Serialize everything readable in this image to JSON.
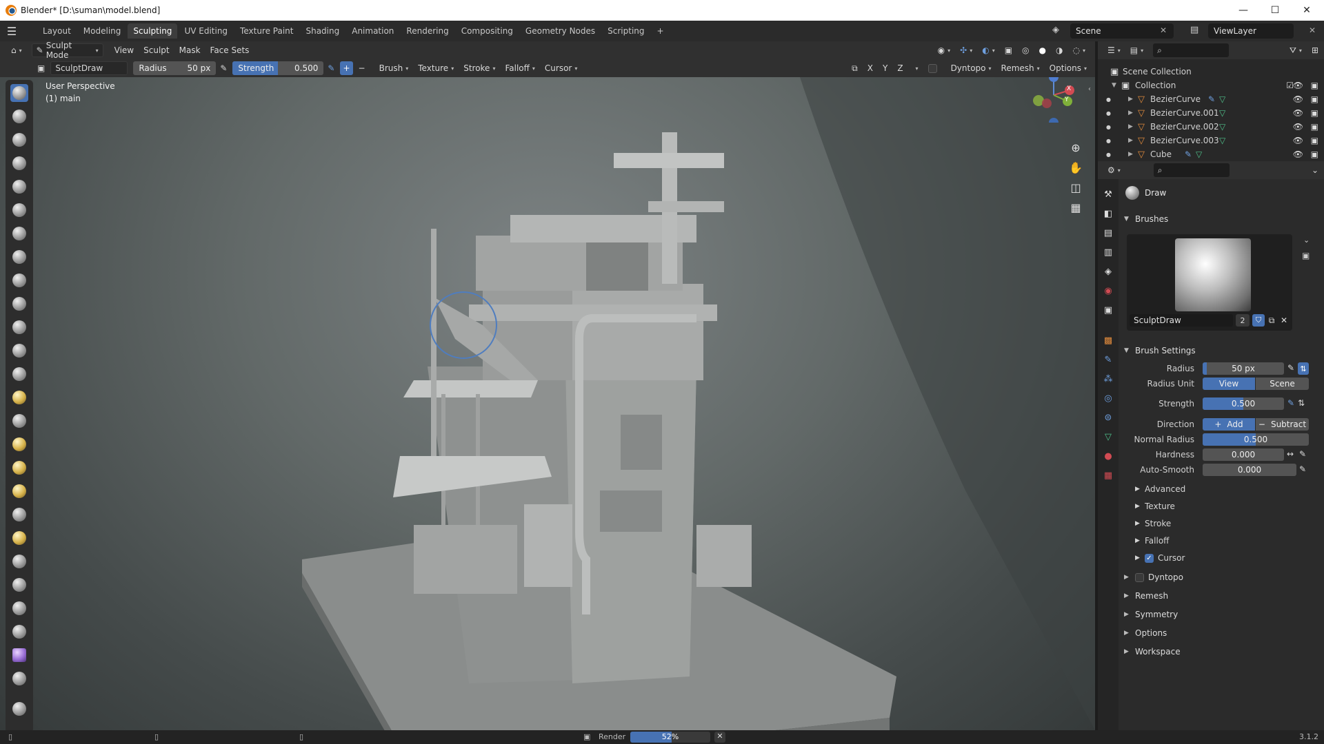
{
  "window": {
    "title": "Blender* [D:\\suman\\model.blend]"
  },
  "workspaces": [
    "Layout",
    "Modeling",
    "Sculpting",
    "UV Editing",
    "Texture Paint",
    "Shading",
    "Animation",
    "Rendering",
    "Compositing",
    "Geometry Nodes",
    "Scripting"
  ],
  "active_workspace": "Sculpting",
  "scene": "Scene",
  "view_layer": "ViewLayer",
  "header": {
    "mode": "Sculpt Mode",
    "menus": [
      "View",
      "Sculpt",
      "Mask",
      "Face Sets"
    ]
  },
  "tool_settings": {
    "brush_name": "SculptDraw",
    "radius_label": "Radius",
    "radius_value": "50 px",
    "strength_label": "Strength",
    "strength_value": "0.500",
    "strength_fraction": 0.5,
    "popovers": [
      "Brush",
      "Texture",
      "Stroke",
      "Falloff",
      "Cursor"
    ],
    "right": {
      "x": "X",
      "y": "Y",
      "z": "Z",
      "dyntopo": "Dyntopo",
      "remesh": "Remesh",
      "options": "Options"
    }
  },
  "viewport": {
    "perspective": "User Perspective",
    "object": "(1) main",
    "axes": {
      "z": "Z",
      "x": "X",
      "y": "Y"
    }
  },
  "outliner": {
    "root": "Scene Collection",
    "collection": "Collection",
    "items": [
      {
        "name": "BezierCurve"
      },
      {
        "name": "BezierCurve.001"
      },
      {
        "name": "BezierCurve.002"
      },
      {
        "name": "BezierCurve.003"
      },
      {
        "name": "Cube"
      }
    ]
  },
  "properties": {
    "active_tool": "Draw",
    "brushes_panel": "Brushes",
    "brush_name": "SculptDraw",
    "brush_users": "2",
    "brush_settings_panel": "Brush Settings",
    "radius": {
      "label": "Radius",
      "value": "50 px"
    },
    "radius_unit": {
      "label": "Radius Unit",
      "options": [
        "View",
        "Scene"
      ],
      "selected": "View"
    },
    "strength": {
      "label": "Strength",
      "value": "0.500",
      "fraction": 0.5
    },
    "direction": {
      "label": "Direction",
      "options": [
        "Add",
        "Subtract"
      ],
      "selected": "Add"
    },
    "normal_radius": {
      "label": "Normal Radius",
      "value": "0.500",
      "fraction": 0.5
    },
    "hardness": {
      "label": "Hardness",
      "value": "0.000"
    },
    "auto_smooth": {
      "label": "Auto-Smooth",
      "value": "0.000"
    },
    "subpanels": [
      "Advanced",
      "Texture",
      "Stroke",
      "Falloff",
      "Cursor"
    ],
    "cursor_enabled": true,
    "panels": [
      "Dyntopo",
      "Remesh",
      "Symmetry",
      "Options",
      "Workspace"
    ],
    "dyntopo_enabled": false
  },
  "statusbar": {
    "render_label": "Render",
    "progress_text": "52%",
    "progress_fraction": 0.52,
    "version": "3.1.2"
  },
  "colors": {
    "accent": "#4772b3",
    "header": "#303030",
    "panel": "#2b2b2b"
  }
}
